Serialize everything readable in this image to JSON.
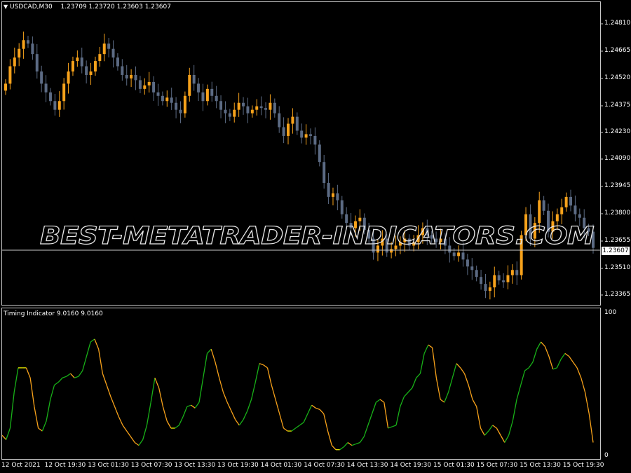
{
  "symbol_line": {
    "dropdown_icon": "triangle-down-icon",
    "symbol": "USDCAD,M30",
    "ohlc": "1.23709 1.23720 1.23603 1.23607"
  },
  "indicator_header": "Timing Indicator 9.0160 9.0160",
  "watermark": "BEST-METATRADER-INDICATORS.COM",
  "colors": {
    "background": "#000000",
    "frame": "#c8c8c8",
    "bull_candle": "#f7a21b",
    "bear_candle": "#5c6b84",
    "doji": "#2fae2f",
    "line_up": "#18b118",
    "line_down": "#f8a21a",
    "line_flat": "#f0f000",
    "text": "#ffffff"
  },
  "price_axis": {
    "ticks": [
      "1.24810",
      "1.24665",
      "1.24520",
      "1.24375",
      "1.24230",
      "1.24090",
      "1.23945",
      "1.23800",
      "1.23655",
      "1.23510",
      "1.23365"
    ],
    "current_price": "1.23607",
    "range": [
      1.233,
      1.2495
    ]
  },
  "indicator_axis": {
    "ticks": [
      "100",
      "0"
    ],
    "range": [
      0,
      100
    ]
  },
  "time_axis": {
    "labels": [
      "12 Oct 2021",
      "12 Oct 19:30",
      "13 Oct 01:30",
      "13 Oct 07:30",
      "13 Oct 13:30",
      "13 Oct 19:30",
      "14 Oct 01:30",
      "14 Oct 07:30",
      "14 Oct 13:30",
      "14 Oct 19:30",
      "15 Oct 01:30",
      "15 Oct 07:30",
      "15 Oct 13:30",
      "15 Oct 19:30"
    ]
  },
  "chart_data": [
    {
      "type": "candlestick",
      "title": "USDCAD,M30",
      "x_label_count": 14,
      "ylim": [
        1.233,
        1.2495
      ],
      "closes": [
        1.2455,
        1.2465,
        1.247,
        1.2475,
        1.248,
        1.2478,
        1.2472,
        1.2462,
        1.2455,
        1.245,
        1.2445,
        1.244,
        1.2445,
        1.2455,
        1.2462,
        1.2468,
        1.247,
        1.2465,
        1.246,
        1.2462,
        1.2468,
        1.2472,
        1.2478,
        1.2475,
        1.247,
        1.2465,
        1.246,
        1.2458,
        1.246,
        1.2457,
        1.2452,
        1.2454,
        1.2456,
        1.245,
        1.2448,
        1.2445,
        1.2447,
        1.2444,
        1.244,
        1.2438,
        1.2448,
        1.246,
        1.2455,
        1.245,
        1.2445,
        1.2452,
        1.2448,
        1.2445,
        1.244,
        1.2438,
        1.2436,
        1.244,
        1.2444,
        1.2442,
        1.2438,
        1.244,
        1.2442,
        1.2441,
        1.244,
        1.2444,
        1.2438,
        1.243,
        1.2425,
        1.2432,
        1.2436,
        1.2428,
        1.2424,
        1.2426,
        1.2425,
        1.242,
        1.241,
        1.2398,
        1.239,
        1.2392,
        1.2388,
        1.238,
        1.2375,
        1.2372,
        1.2376,
        1.2378,
        1.2371,
        1.2366,
        1.2358,
        1.2362,
        1.2366,
        1.2358,
        1.236,
        1.2362,
        1.2364,
        1.2366,
        1.2362,
        1.2364,
        1.2368,
        1.2372,
        1.2368,
        1.2366,
        1.2364,
        1.2366,
        1.2362,
        1.2358,
        1.2356,
        1.2358,
        1.2354,
        1.235,
        1.2348,
        1.2344,
        1.234,
        1.2336,
        1.2338,
        1.2345,
        1.2342,
        1.2341,
        1.2345,
        1.2348,
        1.2345,
        1.2368,
        1.238,
        1.2366,
        1.2375,
        1.2388,
        1.2382,
        1.237,
        1.2376,
        1.238,
        1.2384,
        1.239,
        1.2385,
        1.238,
        1.2378,
        1.2372,
        1.237,
        1.23607
      ]
    },
    {
      "type": "line",
      "title": "Timing Indicator 9.0160 9.0160",
      "ylim": [
        0,
        100
      ],
      "values": [
        15,
        12,
        20,
        45,
        62,
        62,
        62,
        55,
        35,
        20,
        18,
        25,
        40,
        50,
        52,
        55,
        56,
        58,
        55,
        56,
        60,
        70,
        80,
        82,
        75,
        58,
        50,
        42,
        35,
        28,
        22,
        18,
        14,
        10,
        8,
        12,
        22,
        38,
        55,
        48,
        35,
        25,
        20,
        20,
        22,
        28,
        35,
        36,
        34,
        38,
        55,
        72,
        75,
        66,
        55,
        45,
        38,
        32,
        26,
        22,
        26,
        32,
        40,
        52,
        65,
        64,
        62,
        50,
        40,
        30,
        20,
        18,
        18,
        20,
        22,
        24,
        30,
        36,
        34,
        33,
        30,
        18,
        8,
        5,
        5,
        7,
        10,
        8,
        9,
        10,
        14,
        22,
        30,
        38,
        40,
        38,
        20,
        21,
        22,
        35,
        42,
        45,
        48,
        55,
        58,
        72,
        78,
        76,
        55,
        40,
        38,
        45,
        55,
        65,
        62,
        58,
        50,
        40,
        35,
        20,
        15,
        18,
        22,
        20,
        15,
        10,
        15,
        25,
        40,
        50,
        60,
        62,
        66,
        75,
        80,
        77,
        70,
        61,
        62,
        68,
        72,
        70,
        66,
        62,
        55,
        45,
        30,
        10
      ]
    }
  ]
}
